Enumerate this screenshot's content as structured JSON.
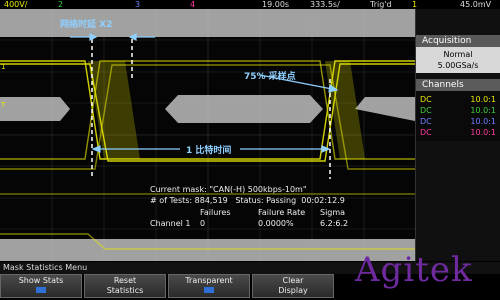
{
  "topbar": {
    "ch1_scale": "400V/",
    "ch2_num": "2",
    "ch3_num": "3",
    "ch4_num": "4",
    "timebase": "19.00s",
    "time_delay": "333.5s/",
    "trig_mode": "Trig'd",
    "trig_source": "1",
    "trig_level": "45.0mV"
  },
  "annotations": {
    "delay_label": "网络时延 X2",
    "sample_label": "75% 采样点",
    "bit_time_label": "1 比特时间"
  },
  "mask": {
    "current_mask": "Current mask: \"CAN(-H) 500kbps-10m\"",
    "tests_line": "# of Tests: 884,519   Status: Passing  00:02:12.9",
    "headers": [
      "Failures",
      "Failure Rate",
      "Sigma"
    ],
    "row_label": "Channel 1",
    "failures": "0",
    "failure_rate": "0.0000%",
    "sigma": "6.2:6.2"
  },
  "acquisition": {
    "title": "Acquisition",
    "mode": "Normal",
    "rate": "5.00GSa/s"
  },
  "channels": {
    "title": "Channels",
    "rows": [
      {
        "coupling": "DC",
        "ratio": "10.0:1",
        "color": "#e8e800"
      },
      {
        "coupling": "DC",
        "ratio": "10.0:1",
        "color": "#3ccf3c"
      },
      {
        "coupling": "DC",
        "ratio": "10.0:1",
        "color": "#6f7cff"
      },
      {
        "coupling": "DC",
        "ratio": "10.0:1",
        "color": "#ff3ca0"
      }
    ]
  },
  "menu": {
    "title": "Mask Statistics Menu",
    "softkeys": [
      {
        "label1": "Show Stats",
        "label2": ""
      },
      {
        "label1": "Reset",
        "label2": "Statistics"
      },
      {
        "label1": "Transparent",
        "label2": ""
      },
      {
        "label1": "Clear",
        "label2": "Display"
      }
    ]
  },
  "watermark": "Agitek",
  "colors": {
    "trace": "#e8e800",
    "mask_fill": "#bdbdbd",
    "annotation": "#8fd0ff",
    "accent": "#2f6fd8"
  }
}
